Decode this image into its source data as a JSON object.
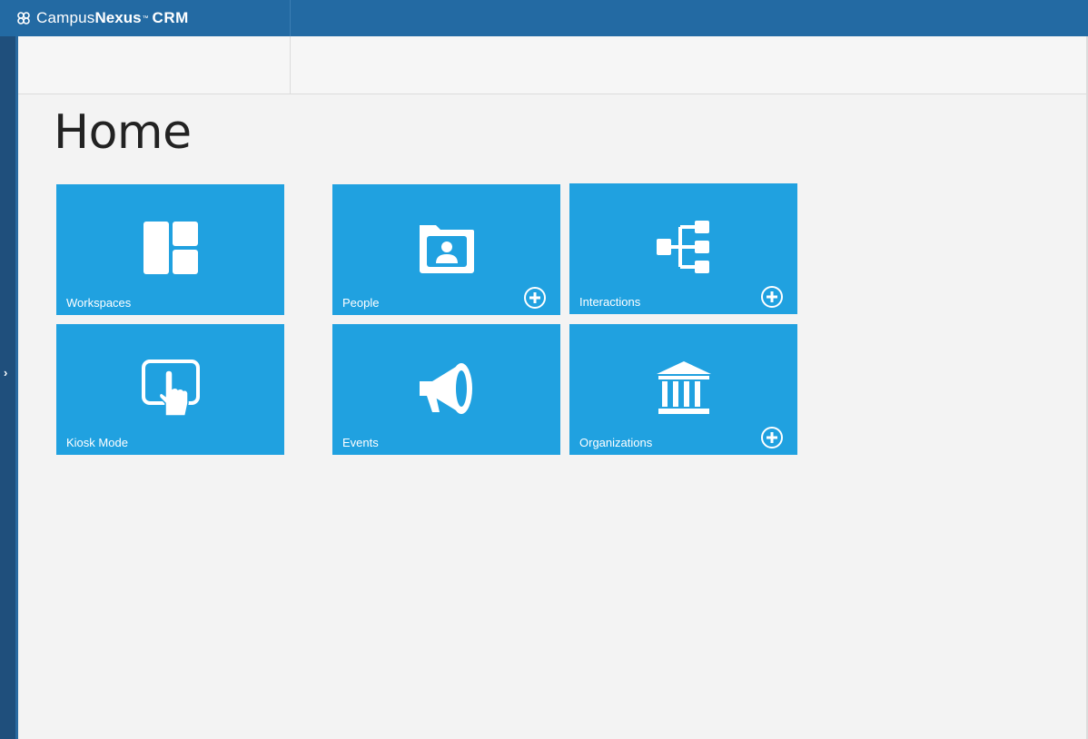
{
  "app": {
    "brand_campus": "Campus",
    "brand_nexus": "Nexus",
    "brand_tm": "™",
    "brand_crm": "CRM",
    "colors": {
      "header": "#236aa3",
      "tile": "#20a1e0",
      "rail": "#1f4f7c",
      "background": "#f3f3f3"
    }
  },
  "side_rail": {
    "expand_glyph": "›"
  },
  "page": {
    "title": "Home"
  },
  "tiles": [
    {
      "label": "Workspaces",
      "icon": "workspaces-icon",
      "has_add": false
    },
    {
      "label": "People",
      "icon": "people-folder-icon",
      "has_add": true
    },
    {
      "label": "Interactions",
      "icon": "interactions-tree-icon",
      "has_add": true
    },
    {
      "label": "Kiosk Mode",
      "icon": "kiosk-touch-icon",
      "has_add": false
    },
    {
      "label": "Events",
      "icon": "megaphone-icon",
      "has_add": false
    },
    {
      "label": "Organizations",
      "icon": "institution-icon",
      "has_add": true
    }
  ]
}
